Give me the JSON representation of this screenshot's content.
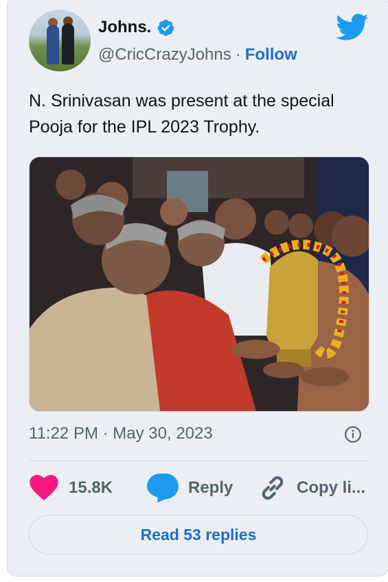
{
  "tweet": {
    "display_name": "Johns.",
    "handle": "@CricCrazyJohns",
    "separator": "·",
    "follow_label": "Follow",
    "text": "N. Srinivasan was present at the special Pooja for the IPL 2023 Trophy.",
    "timestamp": "11:22 PM · May 30, 2023"
  },
  "actions": {
    "likes": "15.8K",
    "reply_label": "Reply",
    "copy_label": "Copy li..."
  },
  "footer": {
    "read_replies_label": "Read 53 replies"
  },
  "colors": {
    "accent_blue": "#1d6fc9",
    "twitter_blue": "#1d9bf0",
    "like_pink": "#f91880",
    "card_bg": "#ebeff3"
  },
  "icons": [
    "verified-badge-icon",
    "twitter-bird-icon",
    "info-icon",
    "heart-icon",
    "reply-bubble-icon",
    "link-icon"
  ]
}
